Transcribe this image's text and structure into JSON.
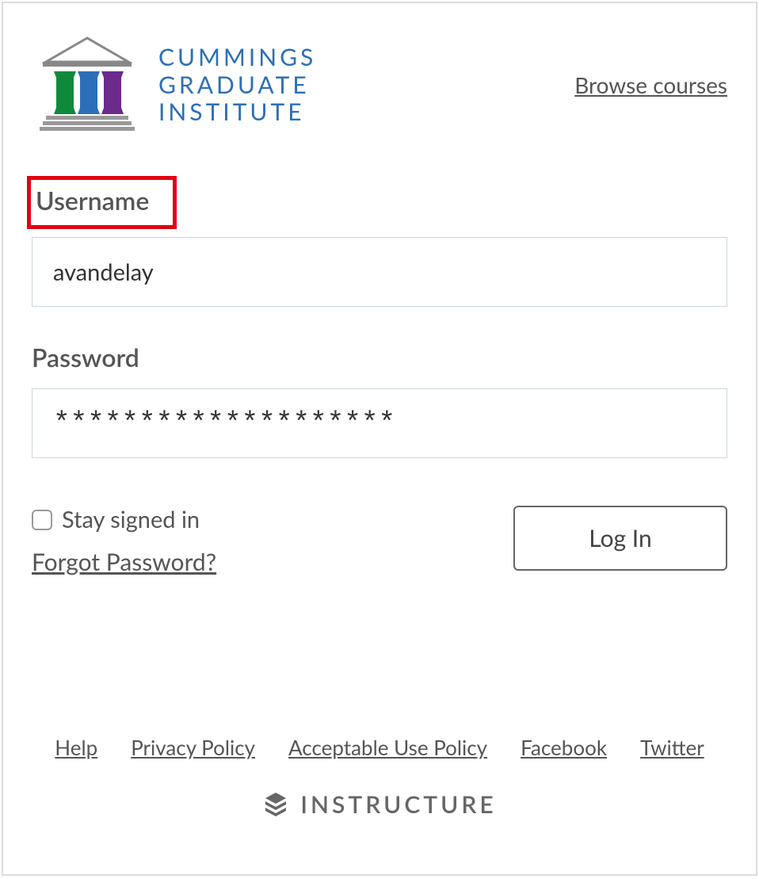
{
  "header": {
    "logo_text_line1": "CUMMINGS",
    "logo_text_line2": "GRADUATE",
    "logo_text_line3": "INSTITUTE",
    "browse_label": "Browse courses"
  },
  "form": {
    "username_label": "Username",
    "username_value": "avandelay",
    "password_label": "Password",
    "password_value": "********************",
    "stay_signed_label": "Stay signed in",
    "forgot_label": "Forgot Password?",
    "login_label": "Log In"
  },
  "footer": {
    "links": {
      "help": "Help",
      "privacy": "Privacy Policy",
      "aup": "Acceptable Use Policy",
      "facebook": "Facebook",
      "twitter": "Twitter"
    },
    "brand": "INSTRUCTURE"
  }
}
